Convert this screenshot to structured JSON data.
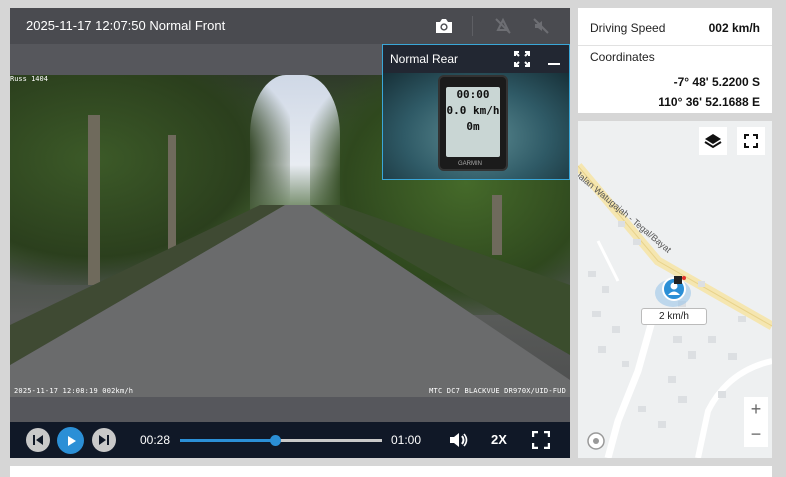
{
  "player": {
    "camera_title": "2025-11-17 12:07:50 Normal Front",
    "icons": [
      "camera-icon",
      "alert-off-icon",
      "mute-off-icon"
    ],
    "osd_top_left": "Russ 1404",
    "osd_timestamp": "2025-11-17 12:08:19 002km/h",
    "osd_device": "MTC DC7 BLACKVUE DR970X/UID-FUD"
  },
  "pip": {
    "title": "Normal Rear",
    "gps_lines": [
      "00:00",
      "0.0 km/h",
      "0m"
    ],
    "brand": "GARMIN"
  },
  "controls": {
    "elapsed": "00:28",
    "duration": "01:00",
    "progress": 0.47,
    "playback_rate": "2X"
  },
  "info": {
    "speed_label": "Driving Speed",
    "speed_value": "002 km/h",
    "coords_label": "Coordinates",
    "latitude": "-7° 48' 5.2200 S",
    "longitude": "110° 36' 52.1688 E"
  },
  "map": {
    "road_name": "Jalan Watugajah - Tegal/Bayat",
    "speed_tag": "2 km/h",
    "zoom_in": "+",
    "zoom_out": "−"
  },
  "colors": {
    "accent": "#2b8fd6",
    "control_bar": "#101827",
    "player_bg": "#56575c"
  }
}
